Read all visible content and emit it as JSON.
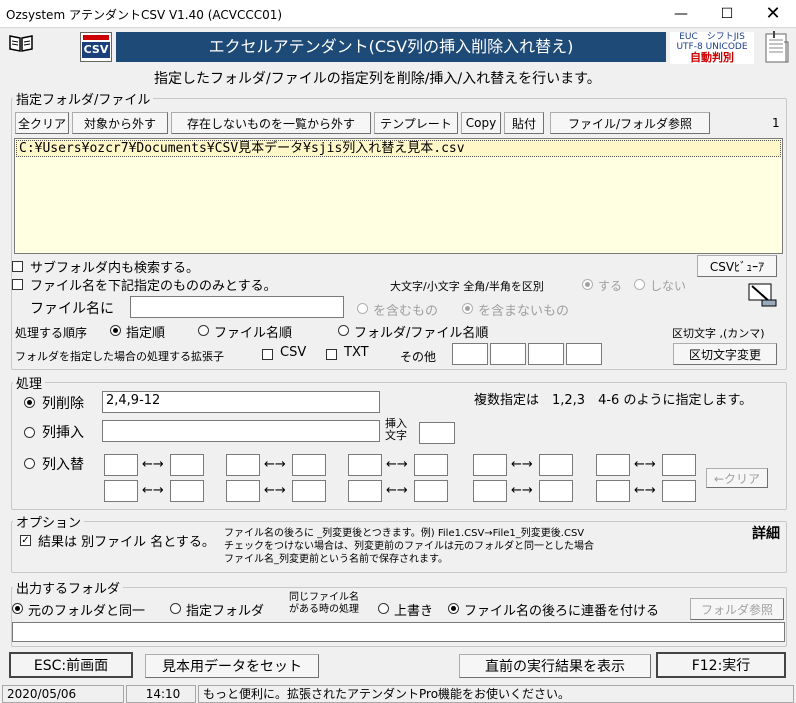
{
  "window": {
    "title": "Ozsystem アテンダントCSV V1.40 (ACVCCC01)"
  },
  "header": {
    "banner": "エクセルアテンダント(CSV列の挿入削除入れ替え)",
    "subtitle": "指定したフォルダ/ファイルの指定列を削除/挿入/入れ替えを行います。",
    "csv_logo": "CSV",
    "enc_line1": "EUC　シフトJIS",
    "enc_line2": "UTF-8 UNICODE",
    "enc_line3": "自動判別"
  },
  "files": {
    "legend": "指定フォルダ/ファイル",
    "clear_all": "全クリア",
    "remove_target": "対象から外す",
    "remove_missing": "存在しないものを一覧から外す",
    "template": "テンプレート",
    "copy": "Copy",
    "paste": "貼付",
    "browse": "ファイル/フォルダ参照",
    "count": "1",
    "list": [
      "C:¥Users¥ozcr7¥Documents¥CSV見本データ¥sjis列入れ替え見本.csv"
    ],
    "include_subfolders": "サブフォルダ内も検索する。",
    "filename_filter": "ファイル名を下記指定のもののみとする。",
    "csv_viewer": "CSVﾋﾞｭｰｱ",
    "case_label": "大文字/小文字 全角/半角を区別",
    "case_yes": "する",
    "case_no": "しない",
    "filename_label": "ファイル名に",
    "filename_value": "",
    "contains": "を含むもの",
    "not_contains": "を含まないもの",
    "order_label": "処理する順序",
    "order_specified": "指定順",
    "order_filename": "ファイル名順",
    "order_folder": "フォルダ/ファイル名順",
    "delimiter_label": "区切文字 ,(カンマ)",
    "ext_label": "フォルダを指定した場合の処理する拡張子",
    "ext_csv": "CSV",
    "ext_txt": "TXT",
    "ext_other": "その他",
    "delimiter_change": "区切文字変更"
  },
  "process": {
    "legend": "処理",
    "delete_label": "列削除",
    "delete_value": "2,4,9-12",
    "hint": "複数指定は　1,2,3　4-6 のように指定します。",
    "insert_label": "列挿入",
    "insert_value": "",
    "insert_char_label1": "挿入",
    "insert_char_label2": "文字",
    "swap_label": "列入替",
    "swap_arrow": "←→",
    "clear": "←クリア"
  },
  "options": {
    "legend": "オプション",
    "separate_file": "結果は 別ファイル 名とする。",
    "note1": "ファイル名の後ろに _列変更後とつきます。例) File1.CSV→File1_列変更後.CSV",
    "note2": "チェックをつけない場合は、列変更前のファイルは元のフォルダと同一とした場合",
    "note3": "ファイル名_列変更前という名前で保存されます。",
    "detail": "詳細"
  },
  "output": {
    "legend": "出力するフォルダ",
    "same_folder": "元のフォルダと同一",
    "specified_folder": "指定フォルダ",
    "same_name_label1": "同じファイル名",
    "same_name_label2": "がある時の処理",
    "overwrite": "上書き",
    "append_number": "ファイル名の後ろに連番を付ける",
    "folder_browse": "フォルダ参照",
    "path_value": ""
  },
  "footer": {
    "esc": "ESC:前画面",
    "sample": "見本用データをセット",
    "last_result": "直前の実行結果を表示",
    "run": "F12:実行"
  },
  "status": {
    "date": "2020/05/06",
    "time": "14:10",
    "message": "もっと便利に。拡張されたアテンダントPro機能をお使いください。"
  }
}
